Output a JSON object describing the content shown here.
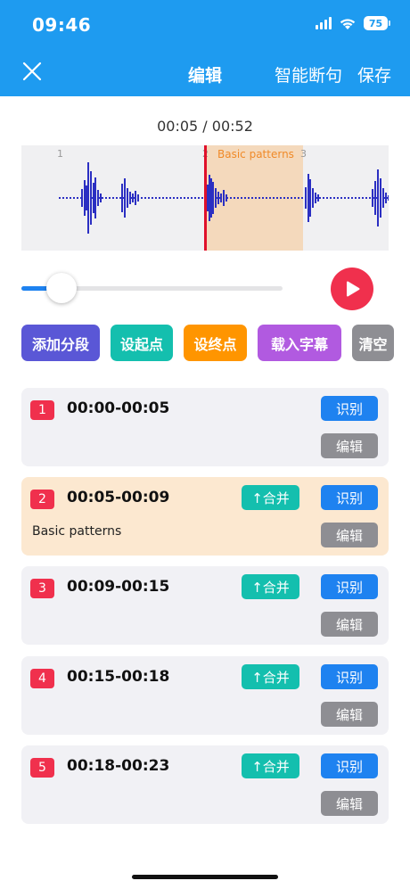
{
  "status_bar": {
    "time": "09:46",
    "battery": "75"
  },
  "nav": {
    "title": "编辑",
    "smart_split": "智能断句",
    "save": "保存"
  },
  "player": {
    "time_readout": "00:05 / 00:52",
    "current_segment_label": "Basic patterns",
    "markers": [
      "1",
      "2",
      "3"
    ],
    "progress": 0.1
  },
  "actions": {
    "add_segment": "添加分段",
    "set_start": "设起点",
    "set_end": "设终点",
    "load_subtitles": "载入字幕",
    "clear": "清空"
  },
  "segments": [
    {
      "num": "1",
      "range": "00:00-00:05",
      "text": "",
      "merge": "",
      "recognize": "识别",
      "edit": "编辑"
    },
    {
      "num": "2",
      "range": "00:05-00:09",
      "text": "Basic patterns",
      "merge": "↑合并",
      "recognize": "识别",
      "edit": "编辑"
    },
    {
      "num": "3",
      "range": "00:09-00:15",
      "text": "",
      "merge": "↑合并",
      "recognize": "识别",
      "edit": "编辑"
    },
    {
      "num": "4",
      "range": "00:15-00:18",
      "text": "",
      "merge": "↑合并",
      "recognize": "识别",
      "edit": "编辑"
    },
    {
      "num": "5",
      "range": "00:18-00:23",
      "text": "",
      "merge": "↑合并",
      "recognize": "识别",
      "edit": "编辑"
    }
  ],
  "colors": {
    "header": "#1e9bf0",
    "accent_red": "#f0304d",
    "merge_teal": "#14bfae",
    "recognize_blue": "#1e82f0",
    "edit_gray": "#8e8e93",
    "add_purple": "#5a57d6",
    "start_teal": "#14bfae",
    "end_orange": "#ff9500",
    "load_violet": "#b15ae0",
    "clear_gray": "#8e8e93",
    "active_segment": "#fce8d0"
  },
  "icons": {
    "close": "close-icon",
    "play": "play-icon",
    "wifi": "wifi-icon",
    "signal": "signal-icon",
    "battery": "battery-icon"
  }
}
